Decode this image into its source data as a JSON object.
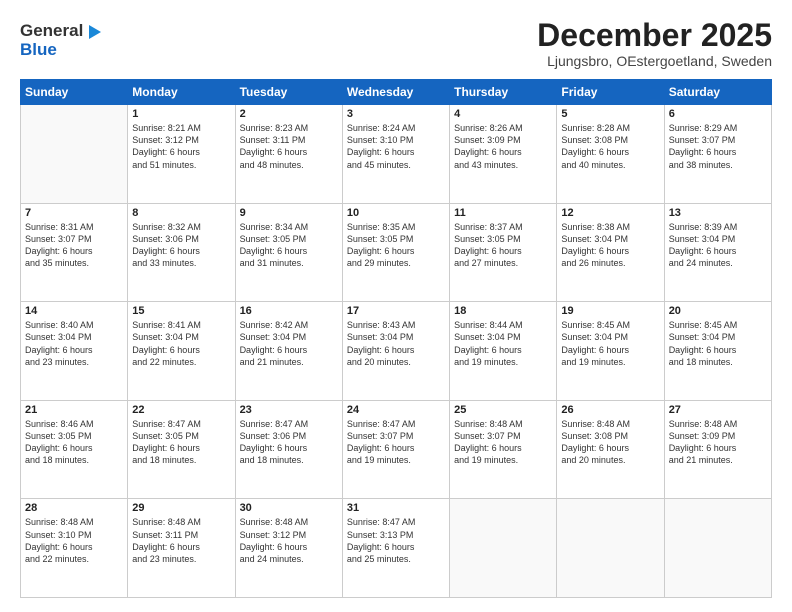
{
  "header": {
    "logo_line1": "General",
    "logo_line2": "Blue",
    "month_title": "December 2025",
    "location": "Ljungsbro, OEstergoetland, Sweden"
  },
  "weekdays": [
    "Sunday",
    "Monday",
    "Tuesday",
    "Wednesday",
    "Thursday",
    "Friday",
    "Saturday"
  ],
  "weeks": [
    [
      {
        "day": "",
        "info": ""
      },
      {
        "day": "1",
        "info": "Sunrise: 8:21 AM\nSunset: 3:12 PM\nDaylight: 6 hours\nand 51 minutes."
      },
      {
        "day": "2",
        "info": "Sunrise: 8:23 AM\nSunset: 3:11 PM\nDaylight: 6 hours\nand 48 minutes."
      },
      {
        "day": "3",
        "info": "Sunrise: 8:24 AM\nSunset: 3:10 PM\nDaylight: 6 hours\nand 45 minutes."
      },
      {
        "day": "4",
        "info": "Sunrise: 8:26 AM\nSunset: 3:09 PM\nDaylight: 6 hours\nand 43 minutes."
      },
      {
        "day": "5",
        "info": "Sunrise: 8:28 AM\nSunset: 3:08 PM\nDaylight: 6 hours\nand 40 minutes."
      },
      {
        "day": "6",
        "info": "Sunrise: 8:29 AM\nSunset: 3:07 PM\nDaylight: 6 hours\nand 38 minutes."
      }
    ],
    [
      {
        "day": "7",
        "info": "Sunrise: 8:31 AM\nSunset: 3:07 PM\nDaylight: 6 hours\nand 35 minutes."
      },
      {
        "day": "8",
        "info": "Sunrise: 8:32 AM\nSunset: 3:06 PM\nDaylight: 6 hours\nand 33 minutes."
      },
      {
        "day": "9",
        "info": "Sunrise: 8:34 AM\nSunset: 3:05 PM\nDaylight: 6 hours\nand 31 minutes."
      },
      {
        "day": "10",
        "info": "Sunrise: 8:35 AM\nSunset: 3:05 PM\nDaylight: 6 hours\nand 29 minutes."
      },
      {
        "day": "11",
        "info": "Sunrise: 8:37 AM\nSunset: 3:05 PM\nDaylight: 6 hours\nand 27 minutes."
      },
      {
        "day": "12",
        "info": "Sunrise: 8:38 AM\nSunset: 3:04 PM\nDaylight: 6 hours\nand 26 minutes."
      },
      {
        "day": "13",
        "info": "Sunrise: 8:39 AM\nSunset: 3:04 PM\nDaylight: 6 hours\nand 24 minutes."
      }
    ],
    [
      {
        "day": "14",
        "info": "Sunrise: 8:40 AM\nSunset: 3:04 PM\nDaylight: 6 hours\nand 23 minutes."
      },
      {
        "day": "15",
        "info": "Sunrise: 8:41 AM\nSunset: 3:04 PM\nDaylight: 6 hours\nand 22 minutes."
      },
      {
        "day": "16",
        "info": "Sunrise: 8:42 AM\nSunset: 3:04 PM\nDaylight: 6 hours\nand 21 minutes."
      },
      {
        "day": "17",
        "info": "Sunrise: 8:43 AM\nSunset: 3:04 PM\nDaylight: 6 hours\nand 20 minutes."
      },
      {
        "day": "18",
        "info": "Sunrise: 8:44 AM\nSunset: 3:04 PM\nDaylight: 6 hours\nand 19 minutes."
      },
      {
        "day": "19",
        "info": "Sunrise: 8:45 AM\nSunset: 3:04 PM\nDaylight: 6 hours\nand 19 minutes."
      },
      {
        "day": "20",
        "info": "Sunrise: 8:45 AM\nSunset: 3:04 PM\nDaylight: 6 hours\nand 18 minutes."
      }
    ],
    [
      {
        "day": "21",
        "info": "Sunrise: 8:46 AM\nSunset: 3:05 PM\nDaylight: 6 hours\nand 18 minutes."
      },
      {
        "day": "22",
        "info": "Sunrise: 8:47 AM\nSunset: 3:05 PM\nDaylight: 6 hours\nand 18 minutes."
      },
      {
        "day": "23",
        "info": "Sunrise: 8:47 AM\nSunset: 3:06 PM\nDaylight: 6 hours\nand 18 minutes."
      },
      {
        "day": "24",
        "info": "Sunrise: 8:47 AM\nSunset: 3:07 PM\nDaylight: 6 hours\nand 19 minutes."
      },
      {
        "day": "25",
        "info": "Sunrise: 8:48 AM\nSunset: 3:07 PM\nDaylight: 6 hours\nand 19 minutes."
      },
      {
        "day": "26",
        "info": "Sunrise: 8:48 AM\nSunset: 3:08 PM\nDaylight: 6 hours\nand 20 minutes."
      },
      {
        "day": "27",
        "info": "Sunrise: 8:48 AM\nSunset: 3:09 PM\nDaylight: 6 hours\nand 21 minutes."
      }
    ],
    [
      {
        "day": "28",
        "info": "Sunrise: 8:48 AM\nSunset: 3:10 PM\nDaylight: 6 hours\nand 22 minutes."
      },
      {
        "day": "29",
        "info": "Sunrise: 8:48 AM\nSunset: 3:11 PM\nDaylight: 6 hours\nand 23 minutes."
      },
      {
        "day": "30",
        "info": "Sunrise: 8:48 AM\nSunset: 3:12 PM\nDaylight: 6 hours\nand 24 minutes."
      },
      {
        "day": "31",
        "info": "Sunrise: 8:47 AM\nSunset: 3:13 PM\nDaylight: 6 hours\nand 25 minutes."
      },
      {
        "day": "",
        "info": ""
      },
      {
        "day": "",
        "info": ""
      },
      {
        "day": "",
        "info": ""
      }
    ]
  ]
}
